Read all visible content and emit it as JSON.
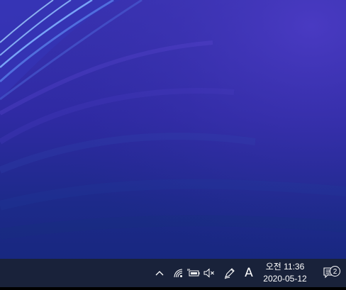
{
  "desktop": {
    "wallpaper_colors": [
      "#3b33b4",
      "#2f2aa3",
      "#15267a",
      "#5d7ae8"
    ]
  },
  "taskbar": {
    "background": "#19223a",
    "tray": {
      "overflow_icon": "chevron-up-icon",
      "network_icon": "wifi-icon",
      "power_icon": "battery-plug-icon",
      "volume_icon": "volume-muted-icon",
      "pen_icon": "pen-workspace-icon",
      "ime_label": "A"
    },
    "clock": {
      "time": "오전 11:36",
      "date": "2020-05-12"
    },
    "notifications": {
      "icon": "action-center-icon",
      "count": "2"
    }
  }
}
